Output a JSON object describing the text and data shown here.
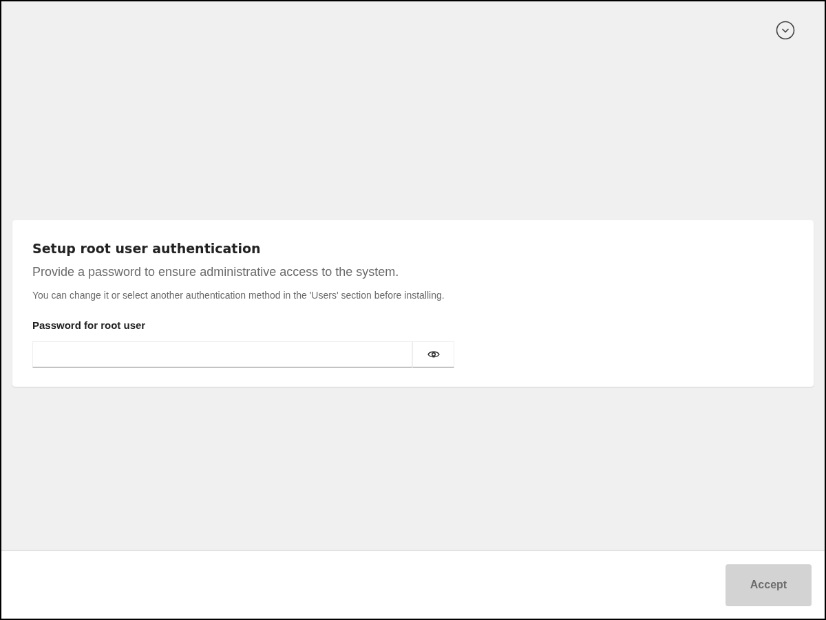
{
  "card": {
    "title": "Setup root user authentication",
    "description": "Provide a password to ensure administrative access to the system.",
    "note": "You can change it or select another authentication method in the 'Users' section before installing.",
    "field": {
      "label": "Password for root user"
    }
  },
  "footer": {
    "button": {
      "label": "Accept",
      "disabled": true
    }
  }
}
